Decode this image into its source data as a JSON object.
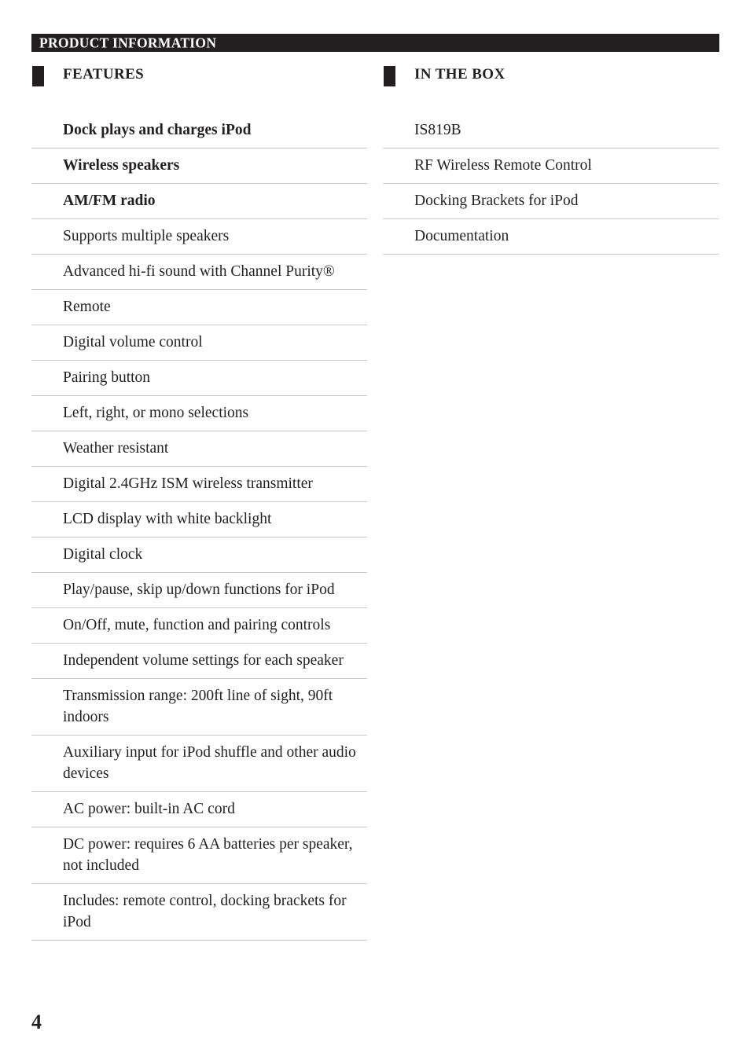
{
  "banner": {
    "title": "PRODUCT INFORMATION"
  },
  "page_number": "4",
  "colors": {
    "ink": "#231f20",
    "banner_background": "#231f20",
    "banner_text": "#ffffff",
    "divider": "#c9c9c9",
    "page_background": "#ffffff"
  },
  "columns": {
    "features": {
      "heading": "FEATURES",
      "marker_icon": "square-marker-icon",
      "items": [
        {
          "text": "Dock plays and charges iPod",
          "bold": true
        },
        {
          "text": "Wireless speakers",
          "bold": true
        },
        {
          "text": "AM/FM radio",
          "bold": true
        },
        {
          "text": "Supports multiple speakers",
          "bold": false
        },
        {
          "text": "Advanced hi-fi sound with Channel Purity®",
          "bold": false
        },
        {
          "text": "Remote",
          "bold": false
        },
        {
          "text": "Digital volume control",
          "bold": false
        },
        {
          "text": "Pairing button",
          "bold": false
        },
        {
          "text": "Left, right, or mono selections",
          "bold": false
        },
        {
          "text": "Weather resistant",
          "bold": false
        },
        {
          "text": "Digital 2.4GHz ISM wireless transmitter",
          "bold": false
        },
        {
          "text": "LCD display with white backlight",
          "bold": false
        },
        {
          "text": "Digital clock",
          "bold": false
        },
        {
          "text": "Play/pause, skip up/down functions for iPod",
          "bold": false
        },
        {
          "text": "On/Off, mute, function and pairing controls",
          "bold": false
        },
        {
          "text": "Independent volume settings for each speaker",
          "bold": false
        },
        {
          "text": "Transmission range: 200ft line of sight, 90ft indoors",
          "bold": false
        },
        {
          "text": "Auxiliary input for iPod shuffle and other audio devices",
          "bold": false
        },
        {
          "text": "AC power: built-in AC cord",
          "bold": false
        },
        {
          "text": "DC power: requires 6 AA batteries per speaker, not included",
          "bold": false
        },
        {
          "text": "Includes: remote control, docking brackets for iPod",
          "bold": false
        }
      ]
    },
    "in_the_box": {
      "heading": "IN THE BOX",
      "marker_icon": "square-marker-icon",
      "items": [
        {
          "text": "IS819B",
          "bold": false
        },
        {
          "text": "RF Wireless Remote Control",
          "bold": false
        },
        {
          "text": "Docking Brackets for iPod",
          "bold": false
        },
        {
          "text": "Documentation",
          "bold": false
        }
      ]
    }
  }
}
